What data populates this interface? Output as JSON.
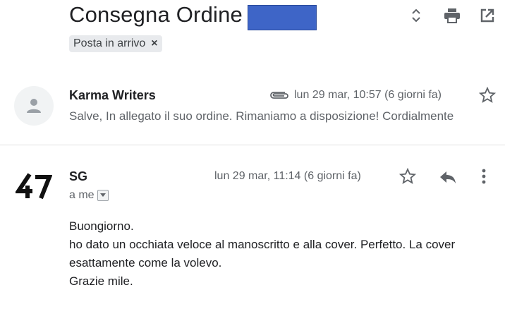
{
  "header": {
    "subject": "Consegna Ordine",
    "label_chip": "Posta in arrivo",
    "chip_remove": "×",
    "redaction_color": "#3e65c7",
    "icons": [
      "expand-collapse-icon",
      "print-icon",
      "open-in-new-window-icon"
    ]
  },
  "messages": [
    {
      "sender": "Karma Writers",
      "date": "lun 29 mar, 10:57 (6 giorni fa)",
      "snippet": "Salve, In allegato il suo ordine. Rimaniamo a disposizione! Cordialmente",
      "has_attachment": true,
      "avatar": "default-person-icon"
    },
    {
      "sender": "SG",
      "date": "lun 29 mar, 11:14 (6 giorni fa)",
      "recipient": "a me",
      "avatar_text": "47",
      "body": [
        "Buongiorno.",
        "ho dato un occhiata veloce al manoscritto e alla cover. Perfetto. La cover",
        "esattamente come la volevo.",
        "Grazie mile."
      ]
    }
  ]
}
